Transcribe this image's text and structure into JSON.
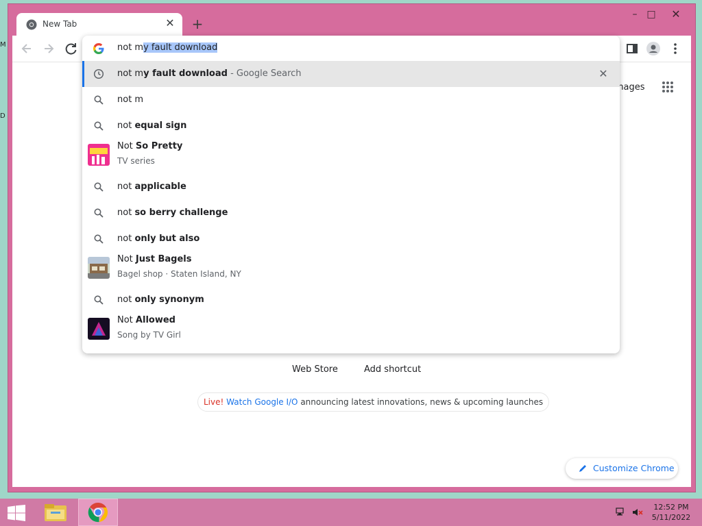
{
  "window": {
    "tab_title": "New Tab",
    "new_tab_symbol": "+",
    "tab_close_symbol": "✕",
    "controls": {
      "minimize": "–",
      "maximize": "□",
      "close": "✕"
    }
  },
  "omnibox": {
    "typed_prefix": "not m",
    "autocompleted": "y fault download",
    "suggestions": [
      {
        "type": "history",
        "icon": "clock-icon",
        "prefix": "not m",
        "bold": "y fault download",
        "suffix": " - Google Search",
        "selected": true,
        "remove": "✕"
      },
      {
        "type": "search",
        "icon": "search-icon",
        "prefix": "not m",
        "bold": ""
      },
      {
        "type": "search",
        "icon": "search-icon",
        "prefix": "not ",
        "bold": "equal sign"
      },
      {
        "type": "entity",
        "prefix": "Not ",
        "bold": "So Pretty",
        "sub": "TV series"
      },
      {
        "type": "search",
        "icon": "search-icon",
        "prefix": "not ",
        "bold": "applicable"
      },
      {
        "type": "search",
        "icon": "search-icon",
        "prefix": "not ",
        "bold": "so berry challenge"
      },
      {
        "type": "search",
        "icon": "search-icon",
        "prefix": "not ",
        "bold": "only but also"
      },
      {
        "type": "entity",
        "prefix": "Not ",
        "bold": "Just Bagels",
        "sub": "Bagel shop · Staten Island, NY"
      },
      {
        "type": "search",
        "icon": "search-icon",
        "prefix": "not ",
        "bold": "only synonym"
      },
      {
        "type": "entity",
        "prefix": "Not ",
        "bold": "Allowed",
        "sub": "Song by TV Girl"
      }
    ]
  },
  "newtab": {
    "images_link": "Images",
    "shortcuts": [
      "Web Store",
      "Add shortcut"
    ],
    "promo": {
      "live": "Live!",
      "link": "Watch Google I/O",
      "rest": " announcing latest innovations, news & upcoming launches"
    },
    "customize_label": "Customize Chrome"
  },
  "taskbar": {
    "time": "12:52 PM",
    "date": "5/11/2022"
  },
  "colors": {
    "window_frame": "#d66c9d",
    "desktop": "#9fd6c8",
    "accent_blue": "#1a73e8",
    "taskbar": "#d07aa5"
  }
}
